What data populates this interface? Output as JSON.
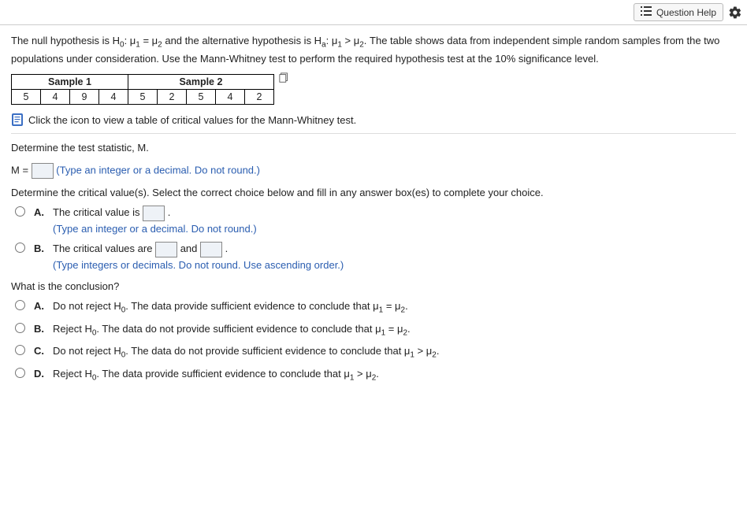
{
  "header": {
    "question_help_label": "Question Help"
  },
  "prompt": {
    "line1_a": "The null hypothesis is H",
    "line1_b": ": μ",
    "line1_c": " = μ",
    "line1_d": " and the alternative hypothesis is H",
    "line1_e": ": μ",
    "line1_f": " > μ",
    "line1_g": ". The table shows data from independent simple random samples from the two populations under consideration. Use the Mann-Whitney test to perform the required hypothesis test at the 10% significance level."
  },
  "table": {
    "sample1_label": "Sample 1",
    "sample2_label": "Sample 2",
    "sample1_values": [
      "5",
      "4",
      "9",
      "4"
    ],
    "sample2_values": [
      "5",
      "2",
      "5",
      "4",
      "2"
    ]
  },
  "icon_link_text": "Click the icon to view a table of critical values for the Mann-Whitney test.",
  "stat_prompt": "Determine the test statistic, M.",
  "m_label": "M = ",
  "m_hint": "(Type an integer or a decimal. Do not round.)",
  "critval_prompt": "Determine the critical value(s). Select the correct choice below and fill in any answer box(es) to complete your choice.",
  "critval_options": {
    "A_pre": "The critical value is ",
    "A_post": ".",
    "A_hint": "(Type an integer or a decimal. Do not round.)",
    "B_pre": "The critical values are ",
    "B_mid": " and ",
    "B_post": ".",
    "B_hint": "(Type integers or decimals. Do not round. Use ascending order.)"
  },
  "conclusion_prompt": "What is the conclusion?",
  "conclusion_options": {
    "A_pre": "Do not reject H",
    "A_post": ". The data provide sufficient evidence to conclude that μ",
    "A_mid": " = μ",
    "A_end": ".",
    "B_pre": "Reject H",
    "B_post": ". The data do not provide sufficient evidence to conclude that μ",
    "B_mid": " = μ",
    "B_end": ".",
    "C_pre": "Do not reject H",
    "C_post": ". The data do not provide sufficient evidence to conclude that μ",
    "C_mid": " > μ",
    "C_end": ".",
    "D_pre": "Reject H",
    "D_post": ". The data provide sufficient evidence to conclude that μ",
    "D_mid": " > μ",
    "D_end": "."
  },
  "letters": {
    "A": "A.",
    "B": "B.",
    "C": "C.",
    "D": "D."
  }
}
